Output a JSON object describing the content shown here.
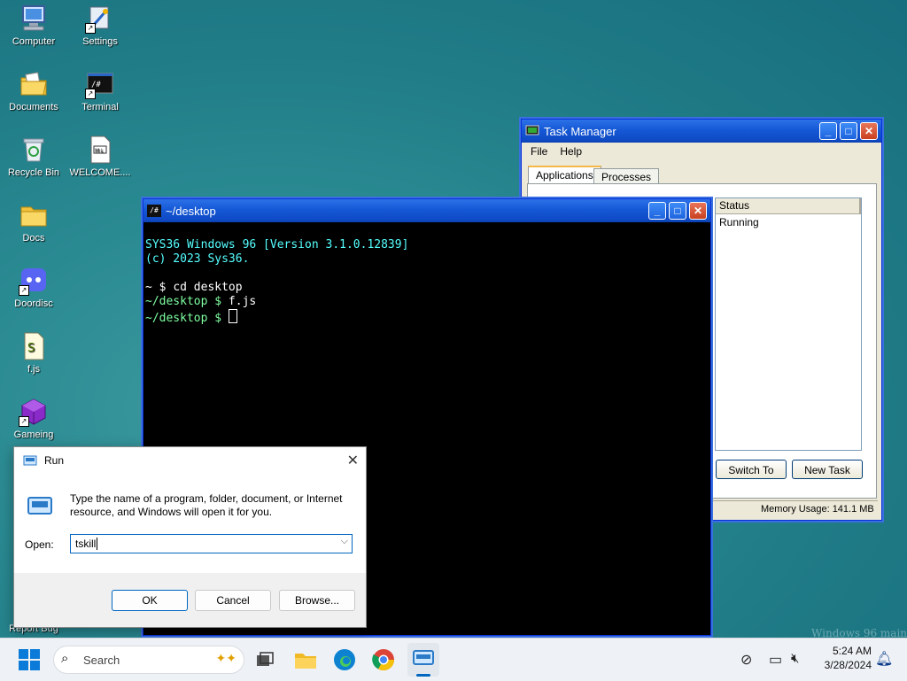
{
  "desktop": {
    "icons": [
      {
        "label": "Computer"
      },
      {
        "label": "Documents"
      },
      {
        "label": "Recycle Bin"
      },
      {
        "label": "Docs"
      },
      {
        "label": "Doordisc"
      },
      {
        "label": "f.js"
      },
      {
        "label": "Gameing"
      },
      {
        "label": "Report Bug"
      },
      {
        "label": "Settings"
      },
      {
        "label": "Terminal"
      },
      {
        "label": "WELCOME...."
      }
    ],
    "watermark": "Windows 96 main"
  },
  "task_manager": {
    "title": "Task Manager",
    "menu": [
      "File",
      "Help"
    ],
    "tabs": [
      "Applications",
      "Processes"
    ],
    "columns": [
      "Status"
    ],
    "rows": [
      {
        "status": "Running"
      }
    ],
    "switch_label": "Switch To",
    "new_task_label": "New Task",
    "memory": "Memory Usage: 141.1 MB"
  },
  "terminal": {
    "title": "~/desktop",
    "icon_text": "/#",
    "lines": [
      {
        "text": "SYS36 Windows 96 [Version 3.1.0.12839]"
      },
      {
        "text": "(c) 2023 Sys36."
      },
      {
        "text": ""
      },
      {
        "prompt": "~ $ ",
        "cmd": "cd desktop"
      },
      {
        "prompt": "~/desktop $ ",
        "cmd": "f.js"
      },
      {
        "prompt": "~/desktop $ ",
        "cmd": ""
      }
    ]
  },
  "run_dialog": {
    "title": "Run",
    "description": "Type the name of a program, folder, document, or Internet resource, and Windows will open it for you.",
    "open_label": "Open:",
    "value": "tskill",
    "ok": "OK",
    "cancel": "Cancel",
    "browse": "Browse..."
  },
  "taskbar": {
    "search_placeholder": "Search",
    "time": "5:24 AM",
    "date": "3/28/2024"
  },
  "colors": {
    "accent": "#0067c0",
    "xp_title": "#1558d6"
  }
}
